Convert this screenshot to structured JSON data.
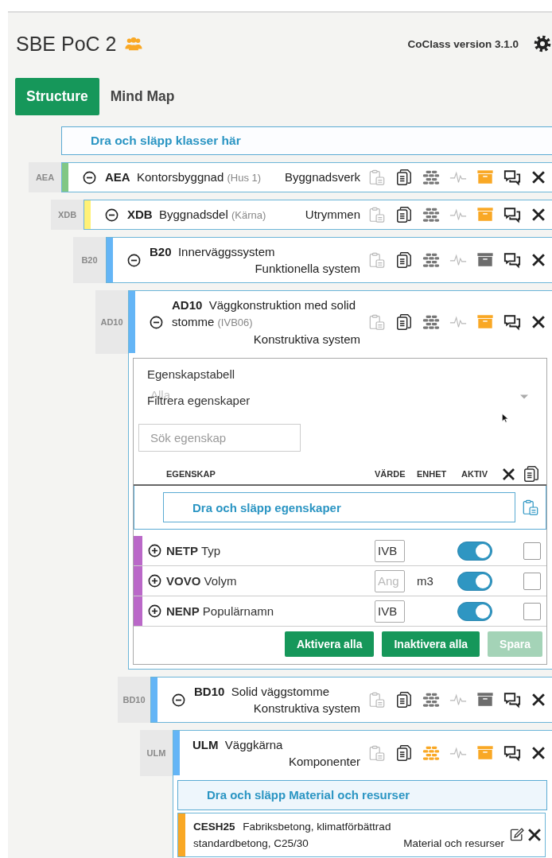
{
  "header": {
    "title": "SBE PoC 2",
    "version": "CoClass version 3.1.0"
  },
  "tabs": [
    {
      "label": "Structure",
      "selected": true
    },
    {
      "label": "Mind Map",
      "selected": false
    }
  ],
  "class_dropzone": {
    "label": "Dra och släpp klasser här"
  },
  "tree": [
    {
      "tag": "AEA",
      "code": "AEA",
      "name": "Kontorsbyggnad",
      "qualifier": "(Hus 1)",
      "category": "Byggnadsverk",
      "color": "#81c784",
      "expanded": true,
      "bricks_active": false,
      "archive_active": true,
      "children": [
        {
          "tag": "XDB",
          "code": "XDB",
          "name": "Byggnadsdel",
          "qualifier": "(Kärna)",
          "category": "Utrymmen",
          "color": "#fff176",
          "expanded": true,
          "bricks_active": false,
          "archive_active": true,
          "children": [
            {
              "tag": "B20",
              "code": "B20",
              "name": "Innerväggssystem",
              "category": "Funktionella system",
              "color": "#64b5f6",
              "expanded": true,
              "bricks_active": false,
              "archive_active": false,
              "children": [
                {
                  "tag": "AD10",
                  "code": "AD10",
                  "name": "Väggkonstruktion med solid stomme",
                  "qualifier": "(IVB06)",
                  "category": "Konstruktiva system",
                  "color": "#64b5f6",
                  "expanded": true,
                  "bricks_active": false,
                  "archive_active": true,
                  "properties": {
                    "title": "Egenskapstabell",
                    "filter": {
                      "label": "Filtrera egenskaper",
                      "placeholder": "Alla"
                    },
                    "search": {
                      "placeholder": "Sök egenskap"
                    },
                    "columns": [
                      "EGENSKAP",
                      "VÄRDE",
                      "ENHET",
                      "AKTIV"
                    ],
                    "dropzone": "Dra och släpp egenskaper",
                    "rows": [
                      {
                        "code": "NETP",
                        "name": "Typ",
                        "value": "IVB",
                        "color": "#ba68c8",
                        "expanded": false,
                        "active": true,
                        "checked": false
                      },
                      {
                        "code": "VOVO",
                        "name": "Volym",
                        "placeholder": "Ang",
                        "unit": "m3",
                        "color": "#ba68c8",
                        "expanded": false,
                        "active": true,
                        "checked": false
                      },
                      {
                        "code": "NENP",
                        "name": "Populärnamn",
                        "value": "IVB",
                        "color": "#ba68c8",
                        "expanded": false,
                        "active": true,
                        "checked": false
                      }
                    ],
                    "buttons": [
                      {
                        "label": "Aktivera alla",
                        "disabled": false
                      },
                      {
                        "label": "Inaktivera alla",
                        "disabled": false
                      },
                      {
                        "label": "Spara",
                        "disabled": true
                      }
                    ]
                  },
                  "children": [
                    {
                      "tag": "BD10",
                      "code": "BD10",
                      "name": "Solid väggstomme",
                      "category": "Konstruktiva system",
                      "color": "#64b5f6",
                      "expanded": true,
                      "bricks_active": false,
                      "archive_active": false,
                      "children": [
                        {
                          "tag": "ULM",
                          "code": "ULM",
                          "name": "Väggkärna",
                          "category": "Komponenter",
                          "color": "#64b5f6",
                          "bricks_active": true,
                          "archive_active": true,
                          "materials": {
                            "dropzone": "Dra och släpp Material och resurser",
                            "items": [
                              {
                                "code": "CESH25",
                                "name": "Fabriksbetong, klimatförbättrad standardbetong, C25/30",
                                "category": "Material och resurser",
                                "color": "#f9a825"
                              }
                            ]
                          }
                        }
                      ]
                    }
                  ]
                }
              ]
            }
          ]
        }
      ]
    }
  ]
}
